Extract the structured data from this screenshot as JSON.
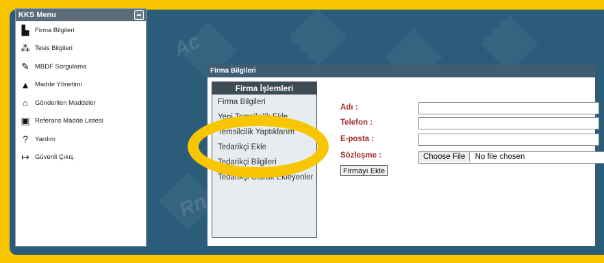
{
  "menu": {
    "title": "KKS Menu",
    "items": [
      {
        "label": "Firma Bilgileri",
        "icon": "factory-icon"
      },
      {
        "label": "Tesis Bilgileri",
        "icon": "network-icon"
      },
      {
        "label": "MBDF Sorgulama",
        "icon": "pen-icon"
      },
      {
        "label": "Madde Yönetimi",
        "icon": "shapes-icon"
      },
      {
        "label": "Gönderilen Maddeler",
        "icon": "bank-icon"
      },
      {
        "label": "Referans Madde Listesi",
        "icon": "document-icon"
      },
      {
        "label": "Yardım",
        "icon": "question-icon"
      },
      {
        "label": "Güvenli Çıkış",
        "icon": "logout-icon"
      }
    ]
  },
  "dialog": {
    "title": "Firma Bilgileri",
    "ops": {
      "header": "Firma İşlemleri",
      "items": [
        "Firma Bilgileri",
        "Yeni Temsilcilik Ekle",
        "Temsilcilik Yaptıklarım",
        "Tedarikçi Ekle",
        "Tedarikçi Bilgileri",
        "Tedarikçi Olarak Ekleyenler"
      ]
    },
    "form": {
      "name_label": "Adı :",
      "phone_label": "Telefon :",
      "email_label": "E-posta :",
      "contract_label": "Sözleşme :",
      "file_button": "Choose File",
      "file_status": "No file chosen",
      "submit": "Firmayı Ekle"
    }
  },
  "background": {
    "letter1": "Ac",
    "letter2": "Rn"
  },
  "colors": {
    "highlight": "#f7c600",
    "label": "#a52a2a",
    "background": "#2b5c7a"
  }
}
